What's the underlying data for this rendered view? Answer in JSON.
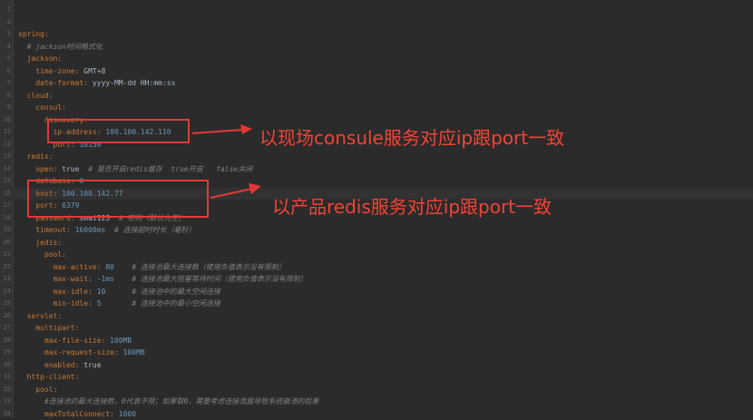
{
  "colors": {
    "background": "#2b2b2b",
    "key": "#cc7832",
    "value": "#a9b7c6",
    "number": "#6897bb",
    "comment": "#808080",
    "annotation": "#f44336"
  },
  "lines": [
    {
      "n": "1",
      "indent": 0,
      "key": "",
      "val": "",
      "comment": ""
    },
    {
      "n": "2",
      "indent": 0,
      "key": "",
      "val": "",
      "comment": ""
    },
    {
      "n": "3",
      "indent": 0,
      "key": "spring:",
      "val": "",
      "comment": ""
    },
    {
      "n": "4",
      "indent": 2,
      "key": "",
      "val": "",
      "comment": "# jackson时间格式化"
    },
    {
      "n": "5",
      "indent": 2,
      "key": "jackson:",
      "val": "",
      "comment": ""
    },
    {
      "n": "6",
      "indent": 4,
      "key": "time-zone:",
      "val": " GMT+8",
      "comment": ""
    },
    {
      "n": "7",
      "indent": 4,
      "key": "date-format:",
      "val": " yyyy-MM-dd HH:mm:ss",
      "comment": ""
    },
    {
      "n": "8",
      "indent": 2,
      "key": "cloud:",
      "val": "",
      "comment": ""
    },
    {
      "n": "9",
      "indent": 4,
      "key": "consul:",
      "val": "",
      "comment": ""
    },
    {
      "n": "10",
      "indent": 6,
      "key": "discovery:",
      "val": "",
      "comment": ""
    },
    {
      "n": "11",
      "indent": 8,
      "key": "ip-address:",
      "val": " 100.100.142.110",
      "comment": ""
    },
    {
      "n": "12",
      "indent": 8,
      "key": "port:",
      "val": " 10150",
      "comment": ""
    },
    {
      "n": "13",
      "indent": 2,
      "key": "redis:",
      "val": "",
      "comment": ""
    },
    {
      "n": "14",
      "indent": 4,
      "key": "open:",
      "val": " true",
      "comment": "  # 是否开启redis缓存  true开启   false关闭"
    },
    {
      "n": "15",
      "indent": 4,
      "key": "database:",
      "val": " 0",
      "comment": ""
    },
    {
      "n": "16",
      "indent": 4,
      "key": "host:",
      "val": " 100.100.142.77",
      "comment": ""
    },
    {
      "n": "17",
      "indent": 4,
      "key": "port:",
      "val": " 6379",
      "comment": ""
    },
    {
      "n": "18",
      "indent": 4,
      "key": "password:",
      "val": " smai123",
      "comment": "  # 密码（默认为空）"
    },
    {
      "n": "19",
      "indent": 4,
      "key": "timeout:",
      "val": " 16000ms",
      "comment": "  # 连接超时时长（毫秒）"
    },
    {
      "n": "20",
      "indent": 4,
      "key": "jedis:",
      "val": "",
      "comment": ""
    },
    {
      "n": "21",
      "indent": 6,
      "key": "pool:",
      "val": "",
      "comment": ""
    },
    {
      "n": "22",
      "indent": 8,
      "key": "max-active:",
      "val": " 80",
      "comment": "    # 连接池最大连接数（使用负值表示没有限制）"
    },
    {
      "n": "23",
      "indent": 8,
      "key": "max-wait:",
      "val": " -1ms",
      "comment": "    # 连接池最大阻塞等待时间（使用负值表示没有限制）"
    },
    {
      "n": "24",
      "indent": 8,
      "key": "max-idle:",
      "val": " 10",
      "comment": "      # 连接池中的最大空闲连接"
    },
    {
      "n": "25",
      "indent": 8,
      "key": "min-idle:",
      "val": " 5",
      "comment": "       # 连接池中的最小空闲连接"
    },
    {
      "n": "26",
      "indent": 2,
      "key": "servlet:",
      "val": "",
      "comment": ""
    },
    {
      "n": "27",
      "indent": 4,
      "key": "multipart:",
      "val": "",
      "comment": ""
    },
    {
      "n": "28",
      "indent": 6,
      "key": "max-file-size:",
      "val": " 100MB",
      "comment": ""
    },
    {
      "n": "29",
      "indent": 6,
      "key": "max-request-size:",
      "val": " 100MB",
      "comment": ""
    },
    {
      "n": "30",
      "indent": 6,
      "key": "enabled:",
      "val": " true",
      "comment": ""
    },
    {
      "n": "31",
      "indent": 2,
      "key": "http-client:",
      "val": "",
      "comment": ""
    },
    {
      "n": "32",
      "indent": 4,
      "key": "pool:",
      "val": "",
      "comment": ""
    },
    {
      "n": "33",
      "indent": 6,
      "key": "",
      "val": "",
      "comment": "#连接池的最大连接数，0代表不限；如果取0，需要考虑连接泄露导致系统崩溃的后果"
    },
    {
      "n": "34",
      "indent": 6,
      "key": "maxTotalConnect:",
      "val": " 1000",
      "comment": ""
    }
  ],
  "annotations": {
    "consul": "以现场consule服务对应ip跟port一致",
    "redis": "以产品redis服务对应ip跟port一致"
  }
}
